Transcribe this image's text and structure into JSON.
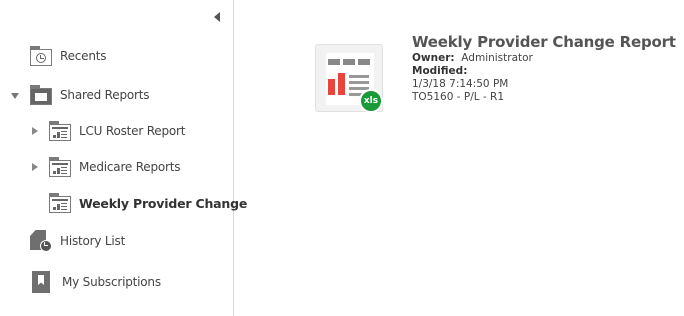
{
  "sidebar": {
    "items": [
      {
        "label": "Recents",
        "icon": "recents-folder-icon"
      },
      {
        "label": "Shared Reports",
        "icon": "shared-folder-icon"
      },
      {
        "label": "LCU Roster Report",
        "icon": "report-folder-icon"
      },
      {
        "label": "Medicare Reports",
        "icon": "report-folder-icon"
      },
      {
        "label": "Weekly Provider Change",
        "icon": "report-folder-icon"
      },
      {
        "label": "History List",
        "icon": "history-icon"
      },
      {
        "label": "My Subscriptions",
        "icon": "bookmark-icon"
      }
    ]
  },
  "report": {
    "title": "Weekly Provider Change Report",
    "owner_label": "Owner:",
    "owner_value": "Administrator",
    "modified_label": "Modified:",
    "modified_value": "1/3/18 7:14:50 PM",
    "code": "TO5160 - P/L - R1",
    "badge": "xls"
  },
  "colors": {
    "accent_red": "#e8453c",
    "badge_green": "#1b9a3a"
  }
}
